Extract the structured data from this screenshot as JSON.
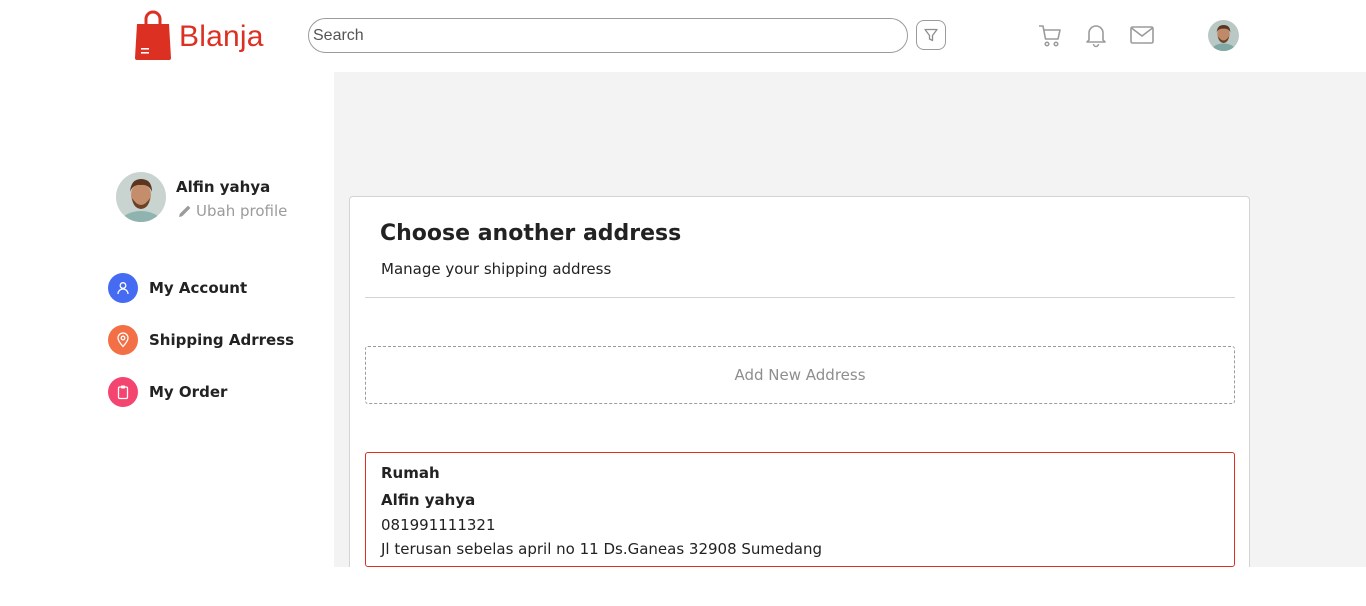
{
  "header": {
    "brand": "Blanja",
    "search_placeholder": "Search",
    "icons": [
      "filter-icon",
      "cart-icon",
      "bell-icon",
      "mail-icon"
    ]
  },
  "profile": {
    "name": "Alfin yahya",
    "edit_label": "Ubah profile"
  },
  "sidebar": {
    "items": [
      {
        "label": "My Account",
        "icon": "user-icon",
        "color": "#456bf3"
      },
      {
        "label": "Shipping Adrress",
        "icon": "location-pin-icon",
        "color": "#f36f45"
      },
      {
        "label": "My Order",
        "icon": "clipboard-icon",
        "color": "#f3456f"
      }
    ]
  },
  "main": {
    "title": "Choose another address",
    "subtitle": "Manage your shipping address",
    "add_label": "Add New Address",
    "address": {
      "label": "Rumah",
      "name": "Alfin yahya",
      "phone": "081991111321",
      "line": "Jl terusan sebelas april no 11 Ds.Ganeas 32908 Sumedang"
    }
  },
  "colors": {
    "brand": "#db3022",
    "main_background": "#f3f3f3"
  }
}
